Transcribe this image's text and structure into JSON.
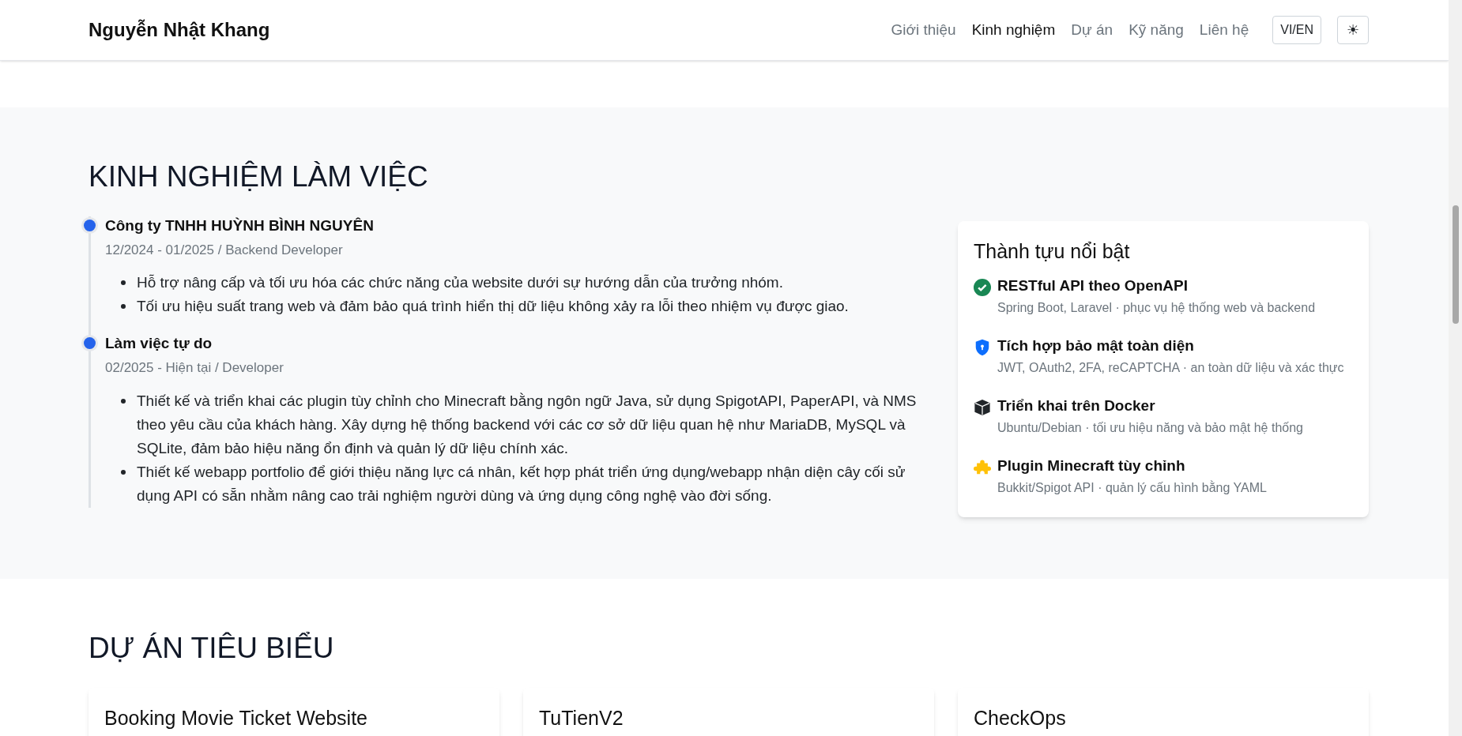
{
  "header": {
    "brand": "Nguyễn Nhật Khang",
    "nav": [
      {
        "label": "Giới thiệu",
        "selected": false
      },
      {
        "label": "Kinh nghiệm",
        "selected": true
      },
      {
        "label": "Dự án",
        "selected": false
      },
      {
        "label": "Kỹ năng",
        "selected": false
      },
      {
        "label": "Liên hệ",
        "selected": false
      }
    ],
    "language_button": "VI/EN",
    "theme_button": "☀"
  },
  "experience": {
    "title": "KINH NGHIỆM LÀM VIỆC",
    "jobs": [
      {
        "company": "Công ty TNHH HUỲNH BÌNH NGUYÊN",
        "meta": "12/2024 - 01/2025 / Backend Developer",
        "bullets": [
          "Hỗ trợ nâng cấp và tối ưu hóa các chức năng của website dưới sự hướng dẫn của trưởng nhóm.",
          "Tối ưu hiệu suất trang web và đảm bảo quá trình hiển thị dữ liệu không xảy ra lỗi theo nhiệm vụ được giao."
        ]
      },
      {
        "company": "Làm việc tự do",
        "meta": "02/2025 - Hiện tại / Developer",
        "bullets": [
          "Thiết kế và triển khai các plugin tùy chỉnh cho Minecraft bằng ngôn ngữ Java, sử dụng SpigotAPI, PaperAPI, và NMS theo yêu cầu của khách hàng. Xây dựng hệ thống backend với các cơ sở dữ liệu quan hệ như MariaDB, MySQL và SQLite, đảm bảo hiệu năng ổn định và quản lý dữ liệu chính xác.",
          "Thiết kế webapp portfolio để giới thiệu năng lực cá nhân, kết hợp phát triển ứng dụng/webapp nhận diện cây cối sử dụng API có sẵn nhằm nâng cao trải nghiệm người dùng và ứng dụng công nghệ vào đời sống."
        ]
      }
    ],
    "achievements": {
      "title": "Thành tựu nổi bật",
      "items": [
        {
          "kind": "check",
          "color": "#198754",
          "title": "RESTful API theo OpenAPI",
          "detail": "Spring Boot, Laravel · phục vụ hệ thống web và backend"
        },
        {
          "kind": "shield",
          "color": "#0d6efd",
          "title": "Tích hợp bảo mật toàn diện",
          "detail": "JWT, OAuth2, 2FA, reCAPTCHA · an toàn dữ liệu và xác thực"
        },
        {
          "kind": "box",
          "color": "#212529",
          "title": "Triển khai trên Docker",
          "detail": "Ubuntu/Debian · tối ưu hiệu năng và bảo mật hệ thống"
        },
        {
          "kind": "puzzle",
          "color": "#ffc107",
          "title": "Plugin Minecraft tùy chỉnh",
          "detail": "Bukkit/Spigot API · quản lý cấu hình bằng YAML"
        }
      ]
    }
  },
  "projects": {
    "title": "DỰ ÁN TIÊU BIỂU",
    "cards": [
      {
        "title": "Booking Movie Ticket Website"
      },
      {
        "title": "TuTienV2"
      },
      {
        "title": "CheckOps"
      }
    ]
  }
}
